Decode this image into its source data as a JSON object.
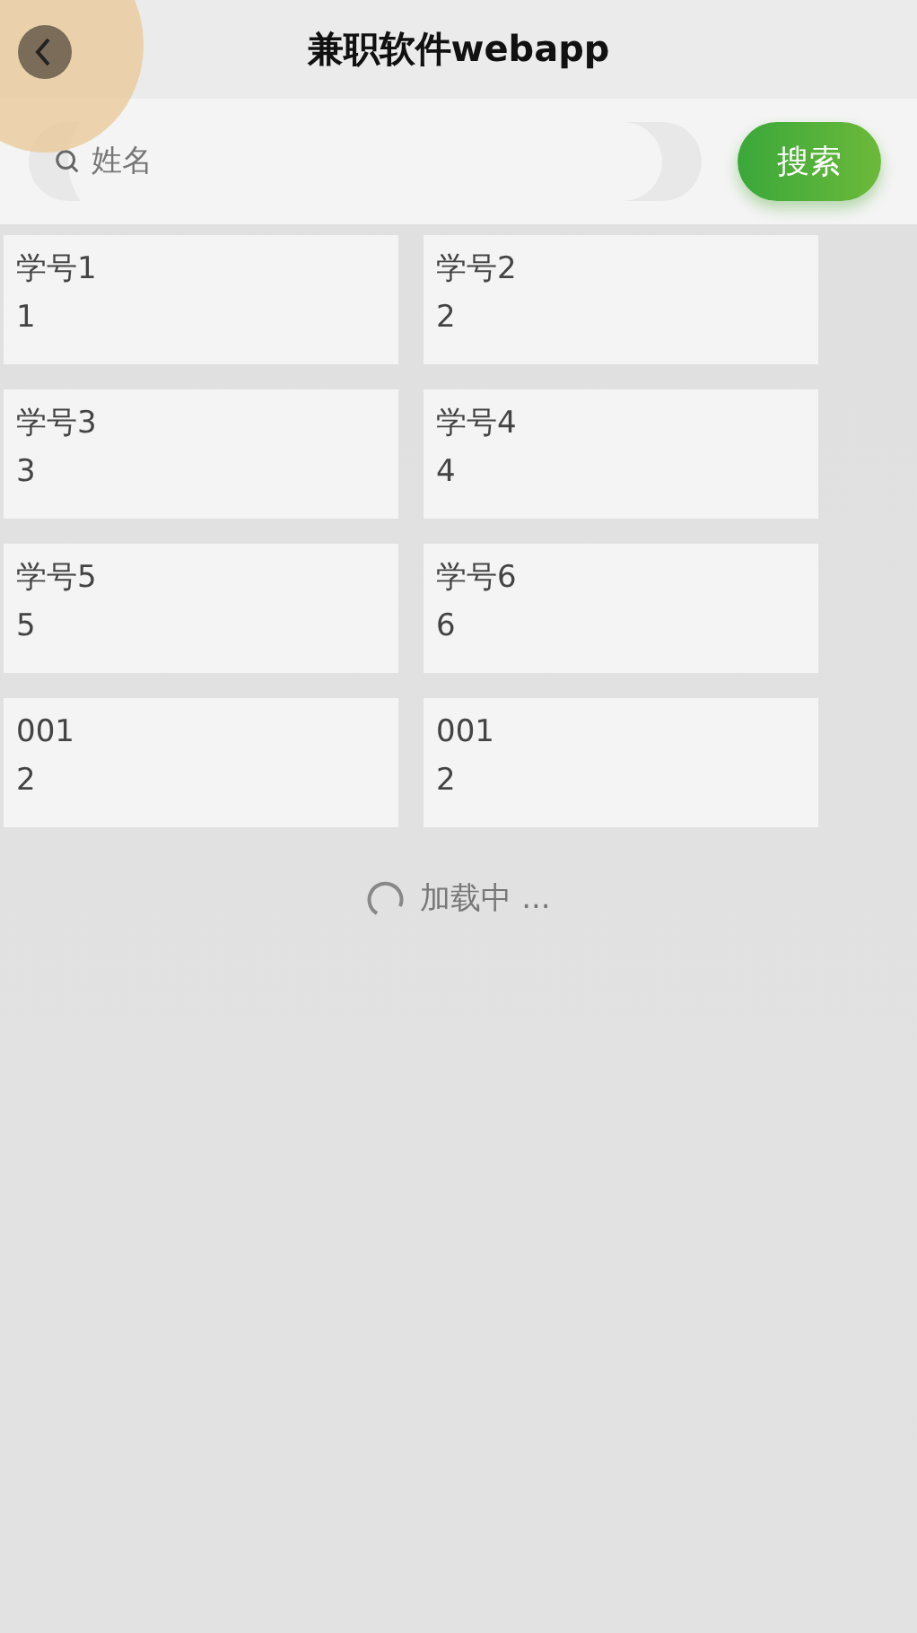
{
  "header": {
    "title": "兼职软件webapp"
  },
  "search": {
    "placeholder": "姓名",
    "button": "搜索"
  },
  "cards": [
    {
      "title": "学号1",
      "value": "1"
    },
    {
      "title": "学号2",
      "value": "2"
    },
    {
      "title": "学号3",
      "value": "3"
    },
    {
      "title": "学号4",
      "value": "4"
    },
    {
      "title": "学号5",
      "value": "5"
    },
    {
      "title": "学号6",
      "value": "6"
    },
    {
      "title": "001",
      "value": "2"
    },
    {
      "title": "001",
      "value": "2"
    }
  ],
  "loading": {
    "text": "加载中 ..."
  }
}
